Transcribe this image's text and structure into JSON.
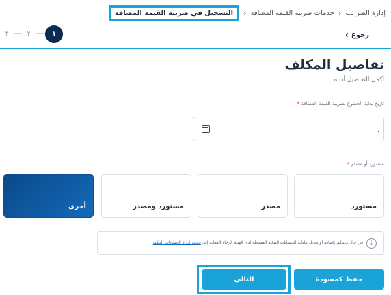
{
  "breadcrumb": {
    "items": [
      "إدارة الضرائب",
      "خدمات ضريبة القيمة المضافة"
    ],
    "current": "التسجيل في ضريبة القيمة المضافة",
    "separator": "›"
  },
  "stepper": {
    "steps": [
      "١",
      "٢",
      "٣"
    ],
    "active_index": 0
  },
  "back_label": "رجوع",
  "page": {
    "title": "تفاصيل المكلف",
    "subtitle": "أكمل التفاصيل أدناه"
  },
  "date_field": {
    "label": "تاريخ بداية الخضوع لضريبة القيمة المضافة",
    "value": ".",
    "required_mark": "*"
  },
  "type_field": {
    "label": "مستورد أو مصدر",
    "required_mark": "*",
    "options": [
      "مستورد",
      "مصدر",
      "مستورد ومصدر",
      "أخرى"
    ],
    "selected": "أخرى"
  },
  "info": {
    "text": "في حال رغبتكم بإضافة أو تعديل بيانات الحسابات البنكية المسجلة لدى الهيئة الرجاء الذهاب إلى",
    "link": "خدمة إدارة الحسابات البنكية"
  },
  "buttons": {
    "next": "التالي",
    "save_draft": "حفظ كمسودة"
  },
  "colors": {
    "accent": "#1aa3d9",
    "selected": "#0c4d8f",
    "step_active": "#0c2a52"
  }
}
